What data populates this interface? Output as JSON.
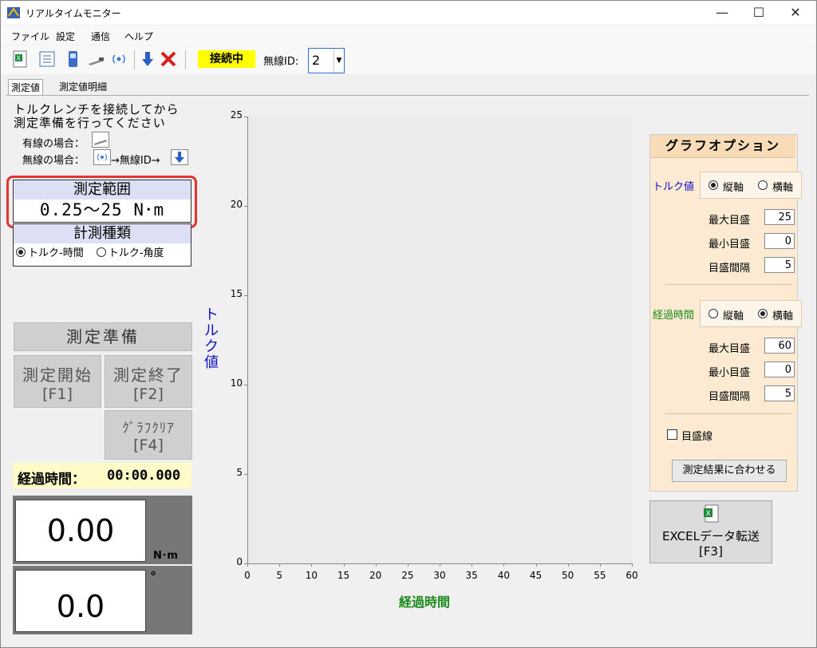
{
  "window": {
    "title": "リアルタイムモニター",
    "min": "—",
    "max": "☐",
    "close": "✕"
  },
  "menu": [
    "ファイル",
    "設定",
    "通信",
    "ヘルプ"
  ],
  "toolbar": {
    "status": "接続中",
    "radio_id_label": "無線ID:",
    "radio_id_value": "2"
  },
  "tabs": [
    "測定値",
    "測定値明細"
  ],
  "instructions": {
    "line1": "トルクレンチを接続してから",
    "line2": "測定準備を行ってください",
    "wired": "有線の場合：",
    "wireless": "無線の場合：",
    "wireless_flow": "→無線ID→"
  },
  "range": {
    "header": "測定範囲",
    "value": "0.25～25 N･m"
  },
  "measurement_type": {
    "header": "計測種類",
    "opt1": "トルク-時間",
    "opt2": "トルク-角度",
    "selected": "トルク-時間"
  },
  "buttons": {
    "prepare": "測定準備",
    "start": "測定開始",
    "start_key": "[F1]",
    "stop": "測定終了",
    "stop_key": "[F2]",
    "clear": "ｸﾞﾗﾌｸﾘｱ",
    "clear_key": "[F4]",
    "excel": "EXCELデータ転送",
    "excel_key": "[F3]"
  },
  "elapsed": {
    "label": "経過時間：",
    "value": "00:00.000"
  },
  "readings": {
    "torque": "0.00",
    "torque_unit": "N･m",
    "angle": "0.0",
    "angle_unit": "°"
  },
  "chart_data": {
    "type": "line",
    "ylabel": "トルク値",
    "xlabel": "経過時間",
    "ylim": [
      0,
      25
    ],
    "xlim": [
      0,
      60
    ],
    "yticks": [
      "0",
      "5",
      "10",
      "15",
      "20",
      "25"
    ],
    "xticks": [
      "0",
      "5",
      "10",
      "15",
      "20",
      "25",
      "30",
      "35",
      "40",
      "45",
      "50",
      "55",
      "60"
    ],
    "series": [],
    "grid": false
  },
  "options": {
    "title": "グラフオプション",
    "torque": {
      "label": "トルク値",
      "vert": "縦軸",
      "horiz": "横軸",
      "selected": "縦軸",
      "max_label": "最大目盛",
      "max": "25",
      "min_label": "最小目盛",
      "min": "0",
      "step_label": "目盛間隔",
      "step": "5"
    },
    "time": {
      "label": "経過時間",
      "vert": "縦軸",
      "horiz": "横軸",
      "selected": "横軸",
      "max_label": "最大目盛",
      "max": "60",
      "min_label": "最小目盛",
      "min": "0",
      "step_label": "目盛間隔",
      "step": "5"
    },
    "gridline_label": "目盛線",
    "fit_button": "測定結果に合わせる"
  },
  "colors": {
    "status": "#ffff00",
    "axis_y": "#1010c8",
    "axis_x": "#1a8a1a",
    "highlight": "#e53232",
    "options_bg": "#fcead2"
  }
}
